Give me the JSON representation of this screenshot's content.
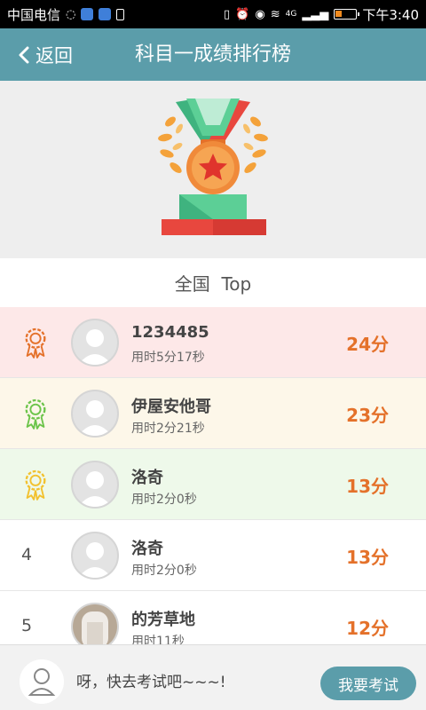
{
  "status_bar": {
    "carrier": "中国电信",
    "network": "4G",
    "time": "下午3:40",
    "battery_level": 0.3,
    "battery_color": "#f08a1e"
  },
  "header": {
    "back_label": "返回",
    "title": "科目一成绩排行榜",
    "bg_color": "#5b9daa"
  },
  "trophy": {
    "icon": "medal-trophy-icon"
  },
  "section": {
    "title": "全国  Top"
  },
  "rankings": [
    {
      "rank": "1",
      "medal_icon": "medal-1-icon",
      "medal_color": "#e4712a",
      "row_color": "#fde8e8",
      "name": "1234485",
      "used": "用时5分17秒",
      "score": "24分",
      "avatar": "default-avatar-icon"
    },
    {
      "rank": "2",
      "medal_icon": "medal-2-icon",
      "medal_color": "#6cc44a",
      "row_color": "#fdf7e9",
      "name": "伊屋安他哥",
      "used": "用时2分21秒",
      "score": "23分",
      "avatar": "default-avatar-icon"
    },
    {
      "rank": "3",
      "medal_icon": "medal-3-icon",
      "medal_color": "#f2c12e",
      "row_color": "#eef9ea",
      "name": "洛奇",
      "used": "用时2分0秒",
      "score": "13分",
      "avatar": "default-avatar-icon"
    },
    {
      "rank": "4",
      "name": "洛奇",
      "used": "用时2分0秒",
      "score": "13分",
      "avatar": "default-avatar-icon"
    },
    {
      "rank": "5",
      "name": "的芳草地",
      "used": "用时11秒",
      "score": "12分",
      "avatar": "photo-avatar"
    }
  ],
  "bottom": {
    "message": "呀，快去考试吧~~~!",
    "button_label": "我要考试",
    "avatar": "user-avatar-icon"
  },
  "colors": {
    "score": "#e4712a",
    "accent": "#5b9daa"
  }
}
